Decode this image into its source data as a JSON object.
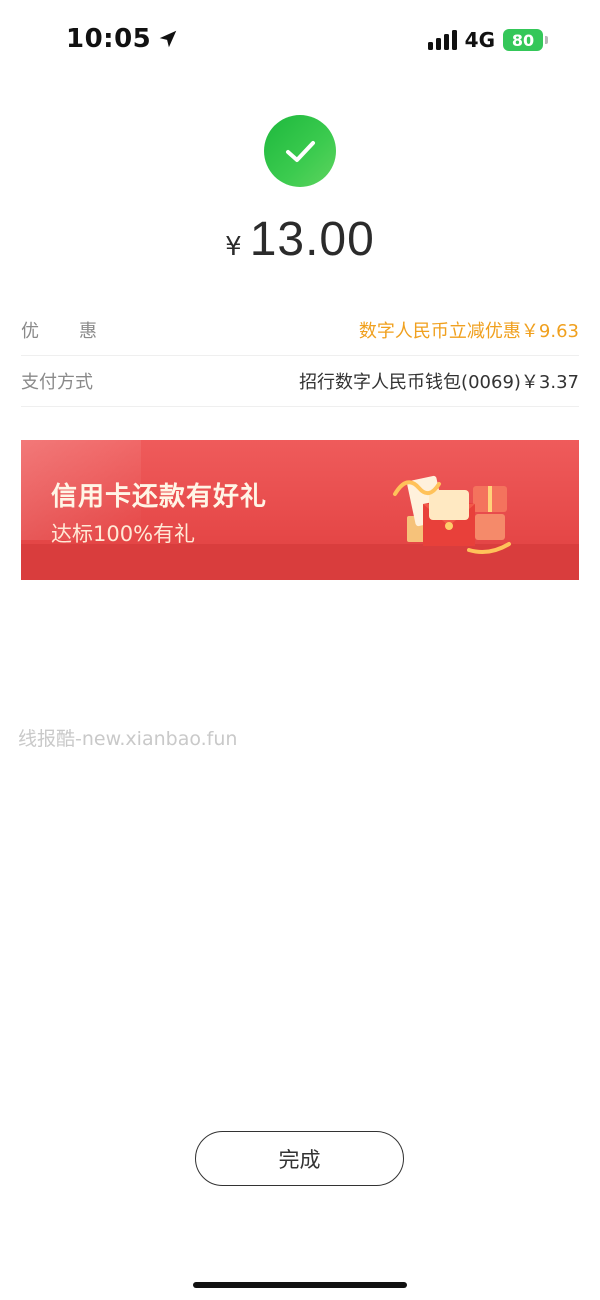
{
  "status_bar": {
    "time": "10:05",
    "network": "4G",
    "battery": "80",
    "location_icon": "location-arrow-icon",
    "signal_icon": "cellular-signal-icon"
  },
  "result": {
    "status_icon": "success-check-icon",
    "currency": "¥",
    "amount": "13.00",
    "accent_color": "#1db83d"
  },
  "details": [
    {
      "label": "优惠",
      "value": "数字人民币立减优惠￥9.63",
      "value_color": "#f0a01e"
    },
    {
      "label": "支付方式",
      "value": "招行数字人民币钱包(0069)￥3.37",
      "value_color": "#333333"
    }
  ],
  "banner": {
    "title": "信用卡还款有好礼",
    "subtitle": "达标100%有礼",
    "background": "#e54747"
  },
  "watermark": "线报酷-new.xianbao.fun",
  "done_button": "完成"
}
